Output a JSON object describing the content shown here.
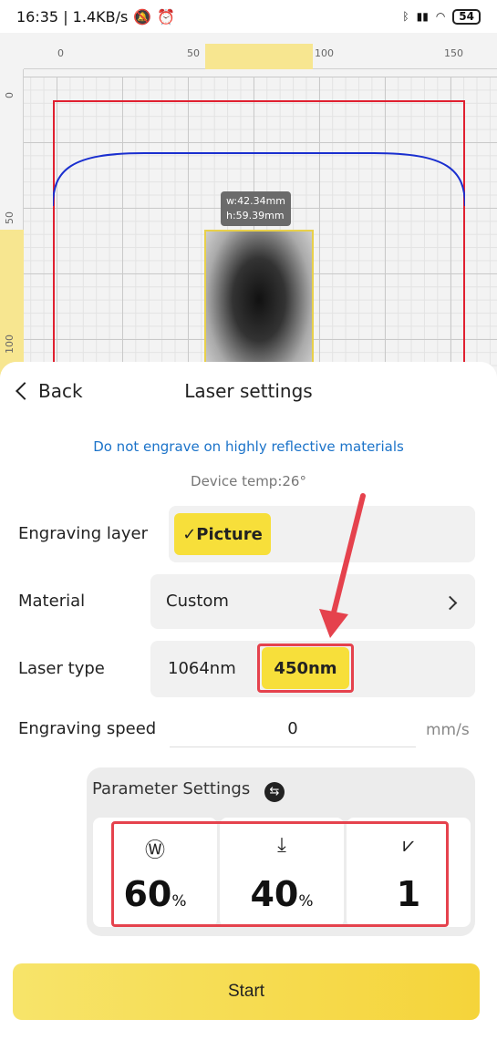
{
  "status_bar": {
    "time_speed": "16:35 | 1.4KB/s",
    "battery": "54"
  },
  "canvas": {
    "ruler_top_ticks": [
      "0",
      "50",
      "100",
      "150"
    ],
    "ruler_left_ticks": [
      "0",
      "50",
      "100"
    ],
    "dimension_width": "w:42.34mm",
    "dimension_height": "h:59.39mm"
  },
  "sheet": {
    "back_label": "Back",
    "title": "Laser settings",
    "warning": "Do not engrave on highly reflective materials",
    "device_temp": "Device temp:26°",
    "engraving_layer": {
      "label": "Engraving layer",
      "selected": "✓Picture"
    },
    "material": {
      "label": "Material",
      "value": "Custom"
    },
    "laser_type": {
      "label": "Laser type",
      "options": [
        "1064nm",
        "450nm"
      ],
      "selected": "450nm"
    },
    "engraving_speed": {
      "label": "Engraving speed",
      "value": "0",
      "unit": "mm/s"
    },
    "parameters": {
      "title": "Parameter Settings",
      "cards": [
        {
          "icon": "power-icon",
          "value": "60",
          "suffix": "%"
        },
        {
          "icon": "depth-icon",
          "value": "40",
          "suffix": "%"
        },
        {
          "icon": "passes-icon",
          "value": "1",
          "suffix": ""
        }
      ]
    },
    "start_label": "Start"
  },
  "colors": {
    "accent_yellow": "#f7df3a",
    "warning_blue": "#1b73c9",
    "annotation_red": "#e5424d"
  }
}
